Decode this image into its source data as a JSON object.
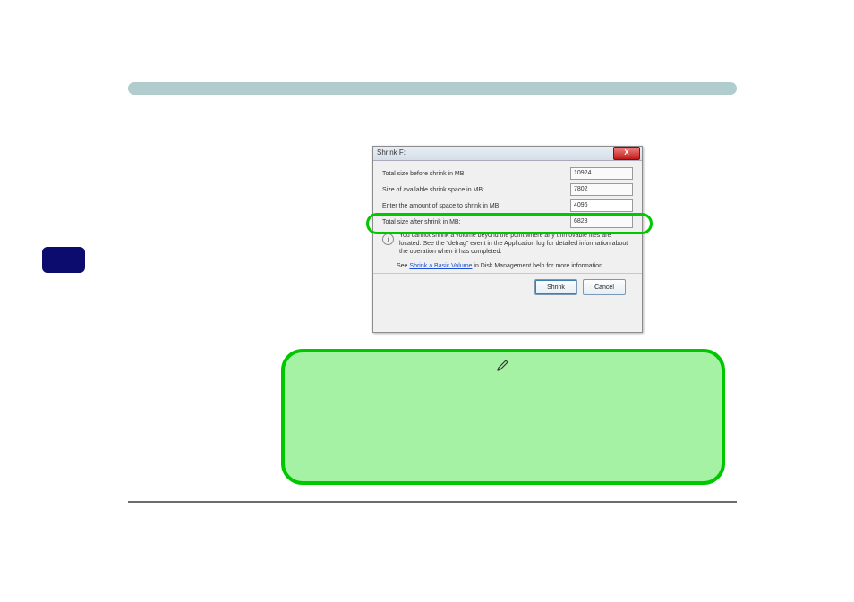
{
  "dialog": {
    "title": "Shrink F:",
    "close_x": "X",
    "rows": [
      {
        "label": "Total size before shrink in MB:",
        "value": "10924"
      },
      {
        "label": "Size of available shrink space in MB:",
        "value": "7802"
      },
      {
        "label": "Enter the amount of space to shrink in MB:",
        "value": "4096"
      },
      {
        "label": "Total size after shrink in MB:",
        "value": "6828"
      }
    ],
    "info_text": "You cannot shrink a volume beyond the point where any unmovable files are located. See the \"defrag\" event in the Application log for detailed information about the operation when it has completed.",
    "help": {
      "prefix": "See ",
      "link_text": "Shrink a Basic Volume",
      "suffix": " in Disk Management help for more information."
    },
    "buttons": {
      "shrink": "Shrink",
      "cancel": "Cancel"
    }
  },
  "colors": {
    "tip_fill": "#a5f2a5",
    "tip_border": "#00c800",
    "teal_bar": "#b0cccc",
    "navy_tab": "#0c0c6e"
  }
}
